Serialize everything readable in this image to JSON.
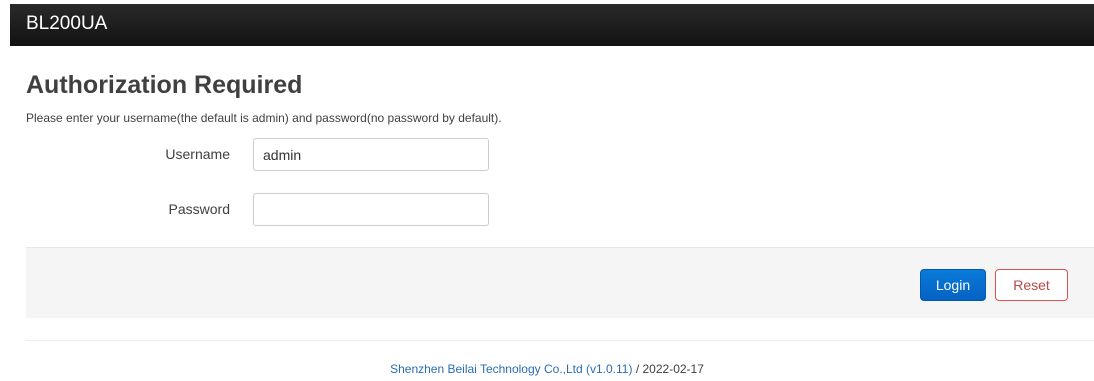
{
  "header": {
    "brand": "BL200UA"
  },
  "auth": {
    "title": "Authorization Required",
    "description": "Please enter your username(the default is admin) and password(no password by default).",
    "username_label": "Username",
    "username_value": "admin",
    "password_label": "Password",
    "password_value": ""
  },
  "actions": {
    "login_label": "Login",
    "reset_label": "Reset"
  },
  "footer": {
    "company_link": "Shenzhen Beilai Technology Co.,Ltd (v1.0.11)",
    "separator": " / ",
    "date": "2022-02-17"
  },
  "colors": {
    "header_bg": "#1a1a1a",
    "primary_button": "#0569d1",
    "reset_border": "#d9534f",
    "link": "#2a6db3"
  }
}
